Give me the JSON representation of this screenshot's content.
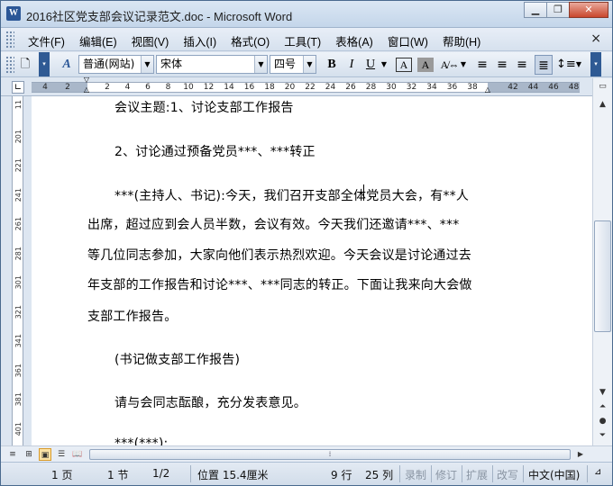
{
  "window": {
    "title": "2016社区党支部会议记录范文.doc - Microsoft Word",
    "icon": "W"
  },
  "menu": {
    "items": [
      "文件(F)",
      "编辑(E)",
      "视图(V)",
      "插入(I)",
      "格式(O)",
      "工具(T)",
      "表格(A)",
      "窗口(W)",
      "帮助(H)"
    ],
    "close": "×"
  },
  "toolbar": {
    "style": "普通(网站)",
    "font": "宋体",
    "size": "四号",
    "bold": "B",
    "italic": "I",
    "underline": "U"
  },
  "ruler": {
    "h_ticks": [
      "4",
      "2",
      "2",
      "4",
      "6",
      "8",
      "10",
      "12",
      "14",
      "16",
      "18",
      "20",
      "22",
      "24",
      "26",
      "28",
      "30",
      "32",
      "34",
      "36",
      "38",
      "42",
      "44",
      "46",
      "48"
    ],
    "v_ticks": [
      "11",
      "201",
      "221",
      "241",
      "261",
      "281",
      "301",
      "321",
      "341",
      "361",
      "381",
      "401"
    ]
  },
  "document": {
    "paragraphs": [
      "会议主题:1、讨论支部工作报告",
      "2、讨论通过预备党员***、***转正",
      "***(主持人、书记):今天，我们召开支部全体党员大会，有**人",
      "出席，超过应到会人员半数，会议有效。今天我们还邀请***、***",
      "等几位同志参加，大家向他们表示热烈欢迎。今天会议是讨论通过去",
      "年支部的工作报告和讨论***、***同志的转正。下面让我来向大会做",
      "支部工作报告。",
      "(书记做支部工作报告)",
      "请与会同志酝酿，充分发表意见。",
      "***(***):"
    ]
  },
  "status": {
    "page": "1 页",
    "section": "1 节",
    "pages": "1/2",
    "position": "位置 15.4厘米",
    "line": "9 行",
    "col": "25 列",
    "rec": "录制",
    "trk": "修订",
    "ext": "扩展",
    "ovr": "改写",
    "lang": "中文(中国)"
  }
}
